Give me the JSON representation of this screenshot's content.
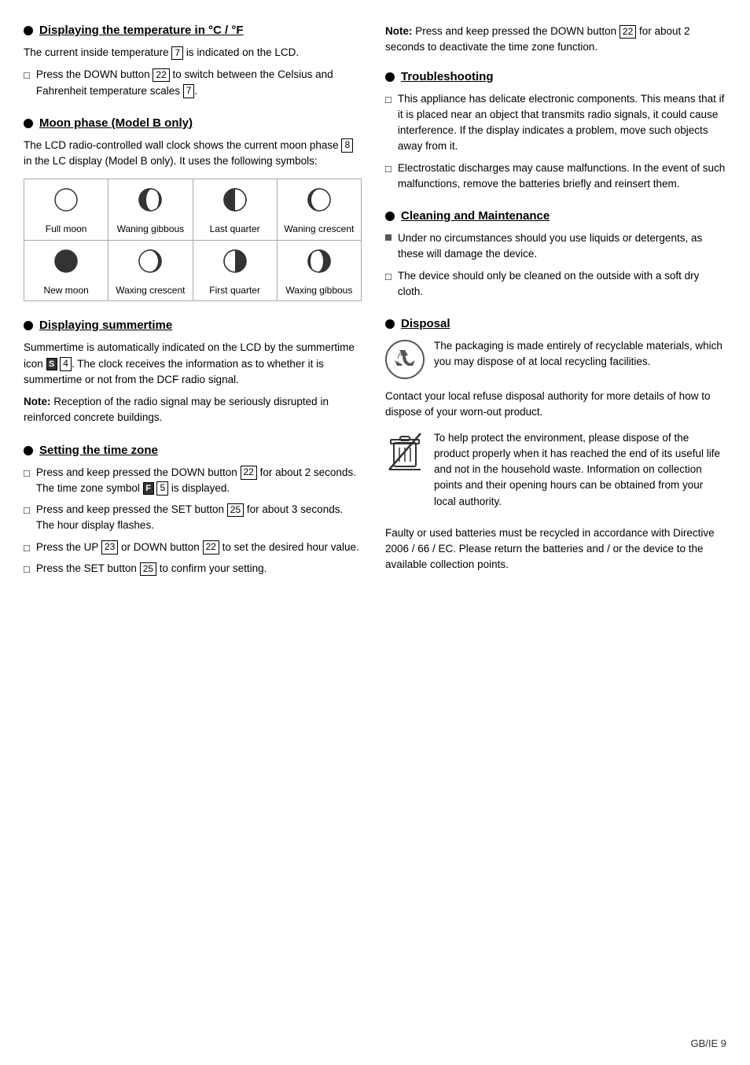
{
  "page": {
    "footer": "GB/IE  9"
  },
  "left": {
    "temp_section": {
      "title": "Displaying the temperature in °C / °F",
      "body1": "The current inside temperature",
      "body1_box": "7",
      "body1_end": "is indicated on the LCD.",
      "list": [
        {
          "text_parts": [
            "Press the DOWN button ",
            "22",
            " to switch between the Celsius and Fahrenheit temperature scales ",
            "7",
            "."
          ]
        }
      ]
    },
    "moon_section": {
      "title": "Moon phase (Model B only)",
      "body1_parts": [
        "The LCD radio-controlled wall clock shows the current moon phase ",
        "8",
        " in the LC display (Model B only). It uses the following symbols:"
      ],
      "moon_phases": [
        {
          "label": "Full moon",
          "type": "full"
        },
        {
          "label": "Waning gibbous",
          "type": "waning-gibbous"
        },
        {
          "label": "Last quarter",
          "type": "last-quarter"
        },
        {
          "label": "Waning crescent",
          "type": "waning-crescent"
        },
        {
          "label": "New moon",
          "type": "new-moon"
        },
        {
          "label": "Waxing crescent",
          "type": "waxing-crescent"
        },
        {
          "label": "First quarter",
          "type": "first-quarter"
        },
        {
          "label": "Waxing gibbous",
          "type": "waxing-gibbous"
        }
      ]
    },
    "summer_section": {
      "title": "Displaying summertime",
      "body1_parts": [
        "Summertime is automatically indicated on the LCD by the summertime icon ",
        "S",
        "4",
        ". The clock receives the information as to whether it is summertime or not from the DCF radio signal."
      ],
      "note_label": "Note:",
      "note_text": " Reception of the radio signal may be seriously disrupted in reinforced concrete buildings."
    },
    "timezone_section": {
      "title": "Setting the time zone",
      "list": [
        {
          "parts": [
            "Press and keep pressed the DOWN button ",
            "22",
            " for about 2 seconds. The time zone symbol ",
            "F",
            "5",
            " is displayed."
          ]
        },
        {
          "parts": [
            "Press and keep pressed the SET button ",
            "25",
            " for about 3 seconds. The hour display flashes."
          ]
        },
        {
          "parts": [
            "Press the UP ",
            "23",
            " or DOWN button ",
            "22",
            " to set the desired hour value."
          ]
        },
        {
          "parts": [
            "Press the SET button ",
            "25",
            " to confirm your setting."
          ]
        }
      ]
    }
  },
  "right": {
    "note_label": "Note:",
    "note_text": " Press and keep pressed the DOWN button ",
    "note_box": "22",
    "note_end": " for about 2 seconds to deactivate the time zone function.",
    "troubleshoot_section": {
      "title": "Troubleshooting",
      "list": [
        "This appliance has delicate electronic components. This means that if it is placed near an object that transmits radio signals, it could cause interference. If the display indicates a problem, move such objects away from it.",
        "Electrostatic discharges may cause malfunctions. In the event of such malfunctions, remove the batteries briefly and reinsert them."
      ]
    },
    "cleaning_section": {
      "title": "Cleaning and Maintenance",
      "list": [
        "Under no circumstances should you use liquids or detergents, as these will damage the device.",
        "The device should only be cleaned on the outside with a soft dry cloth."
      ]
    },
    "disposal_section": {
      "title": "Disposal",
      "recycle_text": "The packaging is made entirely of recyclable materials, which you may dispose of at local recycling facilities.",
      "body1": "Contact your local refuse disposal authority for more details of how to dispose of your worn-out product.",
      "ecowaste_text": "To help protect the environment, please dispose of the product properly when it has reached the end of its useful life and not in the household waste. Information on collection points and their opening hours can be obtained from your local authority.",
      "battery_text": "Faulty or used batteries must be recycled in accordance with Directive 2006 / 66 / EC. Please return the batteries and / or the device to the available collection points."
    }
  }
}
